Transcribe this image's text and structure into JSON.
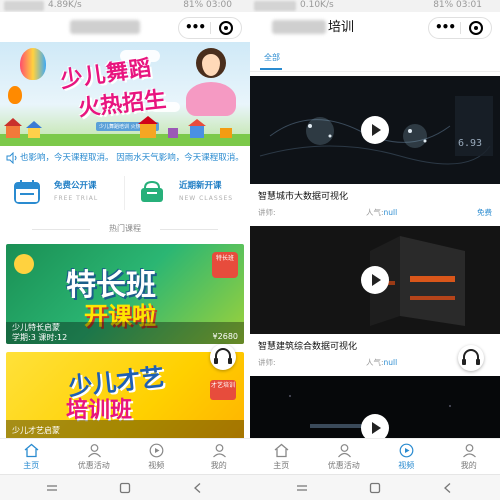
{
  "colors": {
    "accent": "#2a8bd0",
    "text": "#111111",
    "muted": "#999999"
  },
  "left_screen": {
    "status": {
      "left": "4.89K/s",
      "right": "81% 03:00"
    },
    "notice": {
      "icon": "speaker-icon",
      "text": "也影响，今天课程取消。  因雨水天气影响，今天课程取消。"
    },
    "banner": {
      "title_line1": "少儿舞蹈",
      "title_line2": "火热招生",
      "subtitle": "少儿舞蹈培训 火热招生中"
    },
    "quick_links": [
      {
        "title": "免费公开课",
        "sub": "FREE TRIAL",
        "icon": "calendar-icon",
        "color": "#2a8bd0"
      },
      {
        "title": "近期新开课",
        "sub": "NEW CLASSES",
        "icon": "cup-icon",
        "color": "#27b07a"
      }
    ],
    "section_title": "热门课程",
    "courses": [
      {
        "art_line1": "特长班",
        "art_line2": "开课啦",
        "badge": "特长班",
        "name": "少儿特长启蒙",
        "meta": "学期:3 课时:12",
        "price": "¥2680"
      },
      {
        "art_line1": "少儿才艺",
        "art_line2": "培训班",
        "badge": "才艺培训",
        "name": "少儿才艺启蒙"
      }
    ],
    "tabs": [
      {
        "label": "主页",
        "icon": "home-icon",
        "active": true
      },
      {
        "label": "优惠活动",
        "icon": "user-icon",
        "active": false
      },
      {
        "label": "视频",
        "icon": "video-icon",
        "active": false
      },
      {
        "label": "我的",
        "icon": "profile-icon",
        "active": false
      }
    ]
  },
  "right_screen": {
    "status": {
      "left": "0.10K/s",
      "right": "81% 03:01"
    },
    "title": "培训",
    "sub_tab": "全部",
    "videos": [
      {
        "title": "智慧城市大数据可视化",
        "teacher_label": "讲师:",
        "pop_label": "人气:",
        "pop_value": "null",
        "price": "免费"
      },
      {
        "title": "智慧建筑综合数据可视化",
        "teacher_label": "讲师:",
        "pop_label": "人气:",
        "pop_value": "null",
        "price": ""
      },
      {
        "title": "",
        "teacher_label": "",
        "pop_label": "",
        "pop_value": "",
        "price": ""
      }
    ],
    "tabs": [
      {
        "label": "主页",
        "icon": "home-icon",
        "active": false
      },
      {
        "label": "优惠活动",
        "icon": "user-icon",
        "active": false
      },
      {
        "label": "视频",
        "icon": "video-icon",
        "active": true
      },
      {
        "label": "我的",
        "icon": "profile-icon",
        "active": false
      }
    ]
  }
}
